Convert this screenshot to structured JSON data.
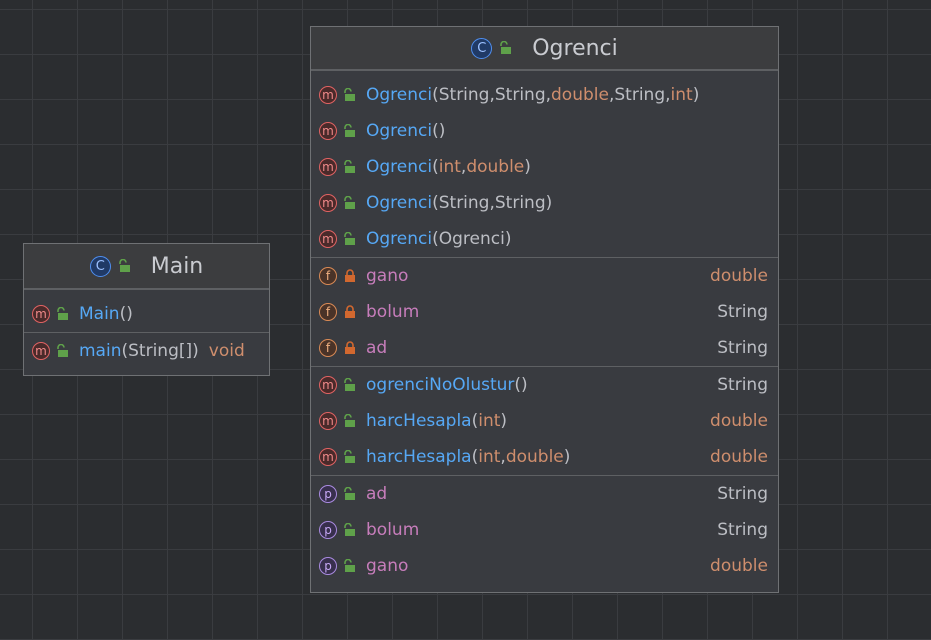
{
  "colors": {
    "method_name": "#56a8f5",
    "field_name": "#c77dbb",
    "primitive": "#cf8e6d",
    "reference": "#bcbec4",
    "public_lock": "#5fa14a",
    "private_lock": "#d2682f"
  },
  "classes": [
    {
      "title": "Ogrenci",
      "icon": "class-icon",
      "sections": [
        [
          {
            "kind": "m",
            "access": "public",
            "name": "Ogrenci",
            "params": [
              {
                "t": "String",
                "k": "ref"
              },
              {
                "t": "String",
                "k": "ref"
              },
              {
                "t": "double",
                "k": "prim"
              },
              {
                "t": "String",
                "k": "ref"
              },
              {
                "t": "int",
                "k": "prim"
              }
            ],
            "type": "",
            "type_kind": ""
          },
          {
            "kind": "m",
            "access": "public",
            "name": "Ogrenci",
            "params": [],
            "type": "",
            "type_kind": ""
          },
          {
            "kind": "m",
            "access": "public",
            "name": "Ogrenci",
            "params": [
              {
                "t": "int",
                "k": "prim"
              },
              {
                "t": "double",
                "k": "prim"
              }
            ],
            "type": "",
            "type_kind": ""
          },
          {
            "kind": "m",
            "access": "public",
            "name": "Ogrenci",
            "params": [
              {
                "t": "String",
                "k": "ref"
              },
              {
                "t": "String",
                "k": "ref"
              }
            ],
            "type": "",
            "type_kind": ""
          },
          {
            "kind": "m",
            "access": "public",
            "name": "Ogrenci",
            "params": [
              {
                "t": "Ogrenci",
                "k": "ref"
              }
            ],
            "type": "",
            "type_kind": ""
          }
        ],
        [
          {
            "kind": "f",
            "access": "private",
            "name": "gano",
            "type": "double",
            "type_kind": "prim"
          },
          {
            "kind": "f",
            "access": "private",
            "name": "bolum",
            "type": "String",
            "type_kind": "ref"
          },
          {
            "kind": "f",
            "access": "private",
            "name": "ad",
            "type": "String",
            "type_kind": "ref"
          }
        ],
        [
          {
            "kind": "m",
            "access": "public",
            "name": "ogrenciNoOlustur",
            "params": [],
            "type": "String",
            "type_kind": "ref"
          },
          {
            "kind": "m",
            "access": "public",
            "name": "harcHesapla",
            "params": [
              {
                "t": "int",
                "k": "prim"
              }
            ],
            "type": "double",
            "type_kind": "prim"
          },
          {
            "kind": "m",
            "access": "public",
            "name": "harcHesapla",
            "params": [
              {
                "t": "int",
                "k": "prim"
              },
              {
                "t": "double",
                "k": "prim"
              }
            ],
            "type": "double",
            "type_kind": "prim"
          }
        ],
        [
          {
            "kind": "p",
            "access": "public",
            "name": "ad",
            "type": "String",
            "type_kind": "ref"
          },
          {
            "kind": "p",
            "access": "public",
            "name": "bolum",
            "type": "String",
            "type_kind": "ref"
          },
          {
            "kind": "p",
            "access": "public",
            "name": "gano",
            "type": "double",
            "type_kind": "prim"
          }
        ]
      ]
    },
    {
      "title": "Main",
      "icon": "class-icon",
      "sections": [
        [
          {
            "kind": "m",
            "access": "public",
            "name": "Main",
            "params": [],
            "type": "",
            "type_kind": ""
          }
        ],
        [
          {
            "kind": "m",
            "access": "public",
            "name": "main",
            "params": [
              {
                "t": "String[]",
                "k": "ref"
              }
            ],
            "type": "void",
            "type_kind": "prim"
          }
        ]
      ]
    }
  ],
  "glyphs": {
    "m": "m",
    "f": "f",
    "p": "p",
    "c": "C",
    "open": "(",
    "close": ")",
    "comma": ", "
  }
}
